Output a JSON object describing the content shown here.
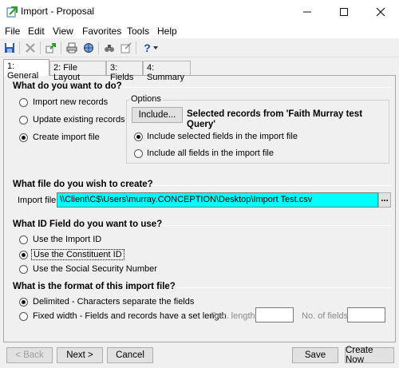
{
  "window": {
    "title": "Import - Proposal"
  },
  "menu": [
    "File",
    "Edit",
    "View",
    "Favorites",
    "Tools",
    "Help"
  ],
  "tabs": [
    {
      "label": "1: General"
    },
    {
      "label": "2: File Layout"
    },
    {
      "label": "3: Fields"
    },
    {
      "label": "4: Summary"
    }
  ],
  "sections": {
    "todo": {
      "heading": "What do you want to do?",
      "options": [
        "Import new records",
        "Update existing records",
        "Create import file"
      ],
      "selected": 2
    },
    "options": {
      "legend": "Options",
      "include_button": "Include...",
      "selected_text": "Selected records from 'Faith Murray test Query'",
      "choices": [
        "Include selected fields in the import file",
        "Include all fields in the import file"
      ],
      "selected": 0
    },
    "file": {
      "heading": "What file do you wish to create?",
      "label": "Import file:",
      "value": "\\\\Client\\C$\\Users\\murray.CONCEPTION\\Desktop\\Import Test.csv",
      "browse": "..."
    },
    "id": {
      "heading": "What ID Field do you want to use?",
      "options": [
        "Use the Import ID",
        "Use the Constituent ID",
        "Use the Social Security Number"
      ],
      "selected": 1
    },
    "format": {
      "heading": "What is the format of this import file?",
      "options": [
        "Delimited - Characters separate the fields",
        "Fixed width - Fields and records have a set length"
      ],
      "selected": 0,
      "rec_length_label": "Rec. length:",
      "num_fields_label": "No. of fields:"
    }
  },
  "buttons": {
    "back": "< Back",
    "next": "Next >",
    "cancel": "Cancel",
    "save": "Save",
    "create_now": "Create Now"
  },
  "colors": {
    "highlight": "#00ffff",
    "accent": "#0078d7"
  }
}
